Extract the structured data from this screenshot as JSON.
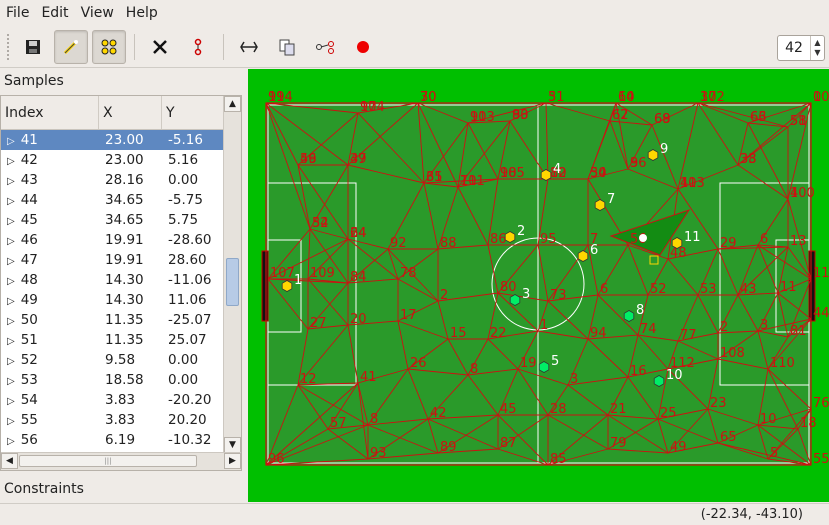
{
  "menu": [
    "File",
    "Edit",
    "View",
    "Help"
  ],
  "spin_value": "42",
  "samples_title": "Samples",
  "constraints_title": "Constraints",
  "table": {
    "columns": [
      "Index",
      "X",
      "Y"
    ],
    "selected_row": 0,
    "rows": [
      [
        "41",
        "23.00",
        "-5.16"
      ],
      [
        "42",
        "23.00",
        "5.16"
      ],
      [
        "43",
        "28.16",
        "0.00"
      ],
      [
        "44",
        "34.65",
        "-5.75"
      ],
      [
        "45",
        "34.65",
        "5.75"
      ],
      [
        "46",
        "19.91",
        "-28.60"
      ],
      [
        "47",
        "19.91",
        "28.60"
      ],
      [
        "48",
        "14.30",
        "-11.06"
      ],
      [
        "49",
        "14.30",
        "11.06"
      ],
      [
        "50",
        "11.35",
        "-25.07"
      ],
      [
        "51",
        "11.35",
        "25.07"
      ],
      [
        "52",
        "9.58",
        "0.00"
      ],
      [
        "53",
        "18.58",
        "0.00"
      ],
      [
        "54",
        "3.83",
        "-20.20"
      ],
      [
        "55",
        "3.83",
        "20.20"
      ],
      [
        "56",
        "6.19",
        "-10.32"
      ]
    ]
  },
  "status_coords": "(-22.34, -43.10)",
  "colors": {
    "pitch": "#00bf00",
    "mesh": "#cc1111",
    "yellow_team": "#ffd700",
    "green_team": "#00ee66",
    "selection": "#5e88c1"
  },
  "field_labels": [
    "99",
    "70",
    "31",
    "60",
    "37",
    "0",
    "97",
    "103",
    "90",
    "62",
    "68",
    "66",
    "58",
    "46",
    "39",
    "35",
    "101",
    "105",
    "82",
    "50",
    "9",
    "113",
    "33",
    "4",
    "54",
    "64",
    "92",
    "88",
    "86",
    "95",
    "7",
    "56",
    "48",
    "29",
    "6",
    "13",
    "111",
    "107",
    "109",
    "84",
    "78",
    "2",
    "80",
    "73",
    "6",
    "52",
    "53",
    "43",
    "11",
    "44",
    "27",
    "20",
    "17",
    "15",
    "22",
    "1",
    "94",
    "74",
    "77",
    "2",
    "3",
    "81",
    "12",
    "41",
    "26",
    "8",
    "19",
    "3",
    "16",
    "112",
    "108",
    "110",
    "76",
    "57",
    "8",
    "42",
    "45",
    "28",
    "21",
    "25",
    "23",
    "10",
    "18",
    "96",
    "93",
    "89",
    "87",
    "85",
    "79",
    "49",
    "65",
    "5",
    "55",
    "114",
    "30",
    "5",
    "14",
    "102",
    "106",
    "104",
    "91",
    "83",
    "67",
    "69",
    "63",
    "51",
    "59",
    "47",
    "61",
    "71",
    "98",
    "10",
    "34",
    "36",
    "40",
    "38",
    "100",
    "32",
    "24"
  ],
  "players": {
    "yellow": [
      {
        "n": "1"
      },
      {
        "n": "2"
      },
      {
        "n": "4"
      },
      {
        "n": "6"
      },
      {
        "n": "7"
      },
      {
        "n": "9"
      },
      {
        "n": "11"
      }
    ],
    "green": [
      {
        "n": "3"
      },
      {
        "n": "5"
      },
      {
        "n": "8"
      },
      {
        "n": "10"
      }
    ]
  }
}
